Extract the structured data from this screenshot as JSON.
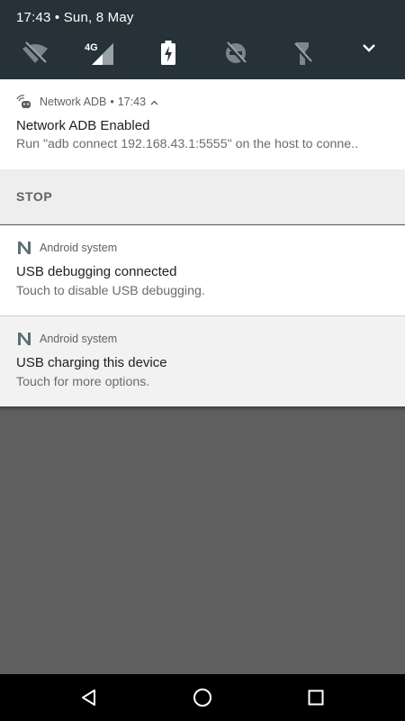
{
  "status_bar": {
    "time_date": "17:43 • Sun, 8 May"
  },
  "quick_settings": {
    "tiles": [
      {
        "icon": "wifi-off-icon"
      },
      {
        "icon": "cellular-4g-icon",
        "badge": "4G"
      },
      {
        "icon": "battery-charging-icon"
      },
      {
        "icon": "do-not-disturb-off-icon"
      },
      {
        "icon": "flashlight-off-icon"
      }
    ],
    "expand_icon": "chevron-down-icon"
  },
  "notifications": [
    {
      "app": "Network ADB",
      "time": "17:43",
      "title": "Network ADB Enabled",
      "text": "Run \"adb connect 192.168.43.1:5555\" on the host to conne..",
      "action": "STOP"
    },
    {
      "app": "Android system",
      "title": "USB debugging connected",
      "text": "Touch to disable USB debugging."
    },
    {
      "app": "Android system",
      "title": "USB charging this device",
      "text": "Touch for more options."
    }
  ],
  "nav_bar": {
    "back": "back-icon",
    "home": "home-icon",
    "recents": "recents-icon"
  },
  "colors": {
    "quick_settings_bg": "#263238",
    "scrim": "#5f5f5f",
    "nav_bar": "#000000"
  }
}
